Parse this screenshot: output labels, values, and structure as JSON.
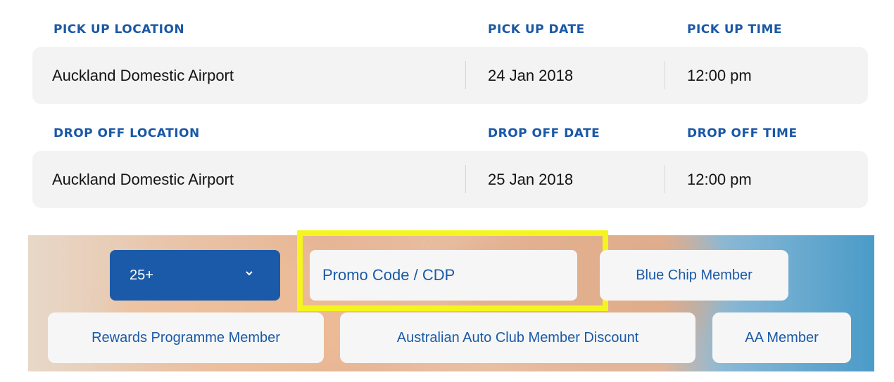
{
  "pickup": {
    "location_label": "PICK UP LOCATION",
    "date_label": "PICK UP DATE",
    "time_label": "PICK UP TIME",
    "location": "Auckland Domestic Airport",
    "date": "24 Jan 2018",
    "time": "12:00 pm"
  },
  "dropoff": {
    "location_label": "DROP OFF LOCATION",
    "date_label": "DROP OFF DATE",
    "time_label": "DROP OFF TIME",
    "location": "Auckland Domestic Airport",
    "date": "25 Jan 2018",
    "time": "12:00 pm"
  },
  "age_select": {
    "value": "25+",
    "icon": "chevron-down-icon"
  },
  "promo": {
    "placeholder": "Promo Code / CDP"
  },
  "memberships": [
    "Blue Chip Member",
    "Rewards Programme Member",
    "Australian Auto Club Member Discount",
    "AA Member"
  ],
  "colors": {
    "brand_blue": "#1a5aa8",
    "highlight": "#f5f51e"
  }
}
